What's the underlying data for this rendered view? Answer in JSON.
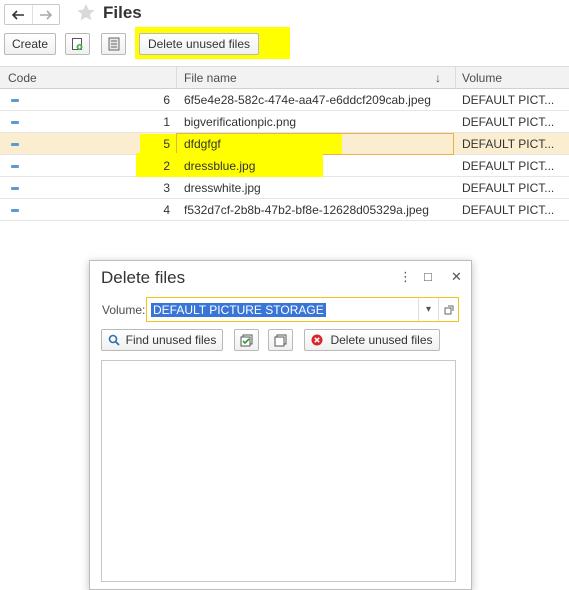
{
  "header": {
    "title": "Files"
  },
  "toolbar": {
    "create_label": "Create",
    "delete_unused_label": "Delete unused files"
  },
  "table": {
    "columns": {
      "code": "Code",
      "file_name": "File name",
      "sort_indicator": "↓",
      "volume": "Volume"
    },
    "rows": [
      {
        "code": "6",
        "file_name": "6f5e4e28-582c-474e-aa47-e6ddcf209cab.jpeg",
        "volume": "DEFAULT PICT..."
      },
      {
        "code": "1",
        "file_name": "bigverificationpic.png",
        "volume": "DEFAULT PICT..."
      },
      {
        "code": "5",
        "file_name": "dfdgfgf",
        "volume": "DEFAULT PICT..."
      },
      {
        "code": "2",
        "file_name": "dressblue.jpg",
        "volume": "DEFAULT PICT..."
      },
      {
        "code": "3",
        "file_name": "dresswhite.jpg",
        "volume": "DEFAULT PICT..."
      },
      {
        "code": "4",
        "file_name": "f532d7cf-2b8b-47b2-bf8e-12628d05329a.jpeg",
        "volume": "DEFAULT PICT..."
      }
    ]
  },
  "dialog": {
    "title": "Delete files",
    "menu_glyph": "⋮",
    "maximize_glyph": "□",
    "close_glyph": "✕",
    "volume_label": "Volume:",
    "volume_value": "DEFAULT PICTURE STORAGE",
    "find_unused_label": "Find unused files",
    "delete_unused_label": "Delete unused files"
  },
  "colors": {
    "highlight": "#ffff00",
    "selected_row": "#fbeed0",
    "accent_blue": "#3875d7",
    "delete_red": "#d9262c"
  }
}
